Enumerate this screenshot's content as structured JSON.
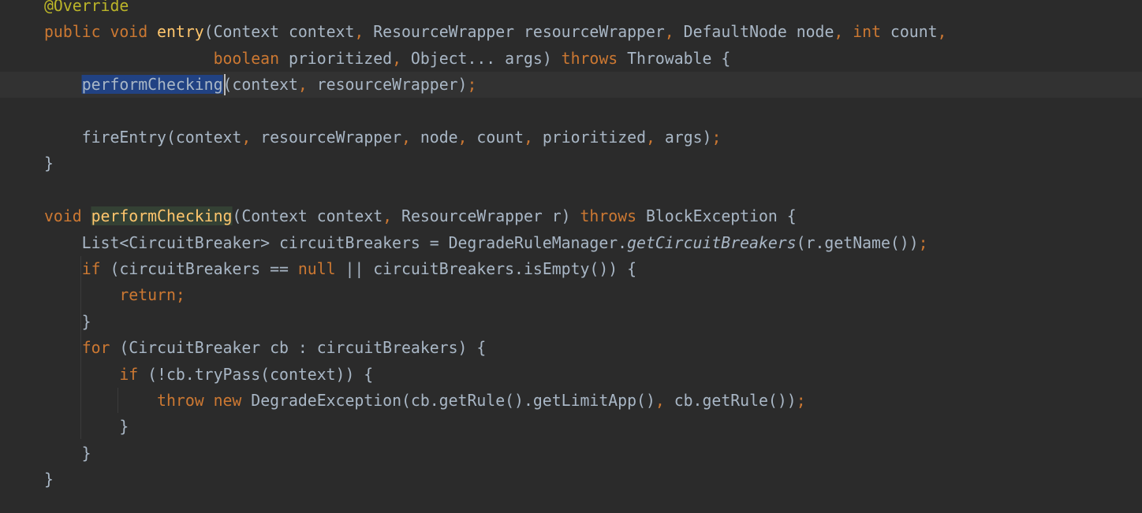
{
  "editor": {
    "language": "java",
    "colors": {
      "background": "#2b2b2b",
      "plain": "#a9b7c6",
      "keyword": "#cc7832",
      "annotation": "#bbb529",
      "method_declaration": "#ffc66d",
      "selection": "#214283",
      "usage_highlight": "#344134",
      "caret_row": "#323232"
    },
    "lines": [
      [
        [
          "ann",
          "@Override"
        ]
      ],
      [
        [
          "kw",
          "public void "
        ],
        [
          "fn",
          "entry"
        ],
        [
          "plain",
          "(Context context"
        ],
        [
          "punct",
          ", "
        ],
        [
          "plain",
          "ResourceWrapper resourceWrapper"
        ],
        [
          "punct",
          ", "
        ],
        [
          "plain",
          "DefaultNode node"
        ],
        [
          "punct",
          ", "
        ],
        [
          "kw",
          "int "
        ],
        [
          "plain",
          "count"
        ],
        [
          "punct",
          ","
        ]
      ],
      [
        [
          "plain",
          "                  "
        ],
        [
          "kw",
          "boolean "
        ],
        [
          "plain",
          "prioritized"
        ],
        [
          "punct",
          ", "
        ],
        [
          "plain",
          "Object... args) "
        ],
        [
          "kw",
          "throws "
        ],
        [
          "plain",
          "Throwable {"
        ]
      ],
      [
        [
          "plain",
          "    "
        ],
        [
          "sel",
          "performChecking"
        ],
        [
          "plain",
          "(context"
        ],
        [
          "punct",
          ", "
        ],
        [
          "plain",
          "resourceWrapper)"
        ],
        [
          "punct",
          ";"
        ]
      ],
      [],
      [
        [
          "plain",
          "    fireEntry(context"
        ],
        [
          "punct",
          ", "
        ],
        [
          "plain",
          "resourceWrapper"
        ],
        [
          "punct",
          ", "
        ],
        [
          "plain",
          "node"
        ],
        [
          "punct",
          ", "
        ],
        [
          "plain",
          "count"
        ],
        [
          "punct",
          ", "
        ],
        [
          "plain",
          "prioritized"
        ],
        [
          "punct",
          ", "
        ],
        [
          "plain",
          "args)"
        ],
        [
          "punct",
          ";"
        ]
      ],
      [
        [
          "plain",
          "}"
        ]
      ],
      [],
      [
        [
          "kw",
          "void "
        ],
        [
          "usage",
          "performChecking"
        ],
        [
          "plain",
          "(Context context"
        ],
        [
          "punct",
          ", "
        ],
        [
          "plain",
          "ResourceWrapper r) "
        ],
        [
          "kw",
          "throws "
        ],
        [
          "plain",
          "BlockException {"
        ]
      ],
      [
        [
          "plain",
          "    List<CircuitBreaker> circuitBreakers = DegradeRuleManager."
        ],
        [
          "italic",
          "getCircuitBreakers"
        ],
        [
          "plain",
          "(r.getName())"
        ],
        [
          "punct",
          ";"
        ]
      ],
      [
        [
          "plain",
          "    "
        ],
        [
          "kw",
          "if "
        ],
        [
          "plain",
          "(circuitBreakers == "
        ],
        [
          "kw",
          "null "
        ],
        [
          "plain",
          "|| circuitBreakers.isEmpty()) {"
        ]
      ],
      [
        [
          "plain",
          "        "
        ],
        [
          "kw",
          "return;"
        ]
      ],
      [
        [
          "plain",
          "    }"
        ]
      ],
      [
        [
          "plain",
          "    "
        ],
        [
          "kw",
          "for "
        ],
        [
          "plain",
          "(CircuitBreaker cb : circuitBreakers) {"
        ]
      ],
      [
        [
          "plain",
          "        "
        ],
        [
          "kw",
          "if "
        ],
        [
          "plain",
          "(!cb.tryPass(context)) {"
        ]
      ],
      [
        [
          "plain",
          "            "
        ],
        [
          "kw",
          "throw new "
        ],
        [
          "plain",
          "DegradeException(cb.getRule().getLimitApp()"
        ],
        [
          "punct",
          ", "
        ],
        [
          "plain",
          "cb.getRule())"
        ],
        [
          "punct",
          ";"
        ]
      ],
      [
        [
          "plain",
          "        }"
        ]
      ],
      [
        [
          "plain",
          "    }"
        ]
      ],
      [
        [
          "plain",
          "}"
        ]
      ]
    ]
  },
  "gutter": {
    "intention_icon": "lightbulb-icon"
  }
}
